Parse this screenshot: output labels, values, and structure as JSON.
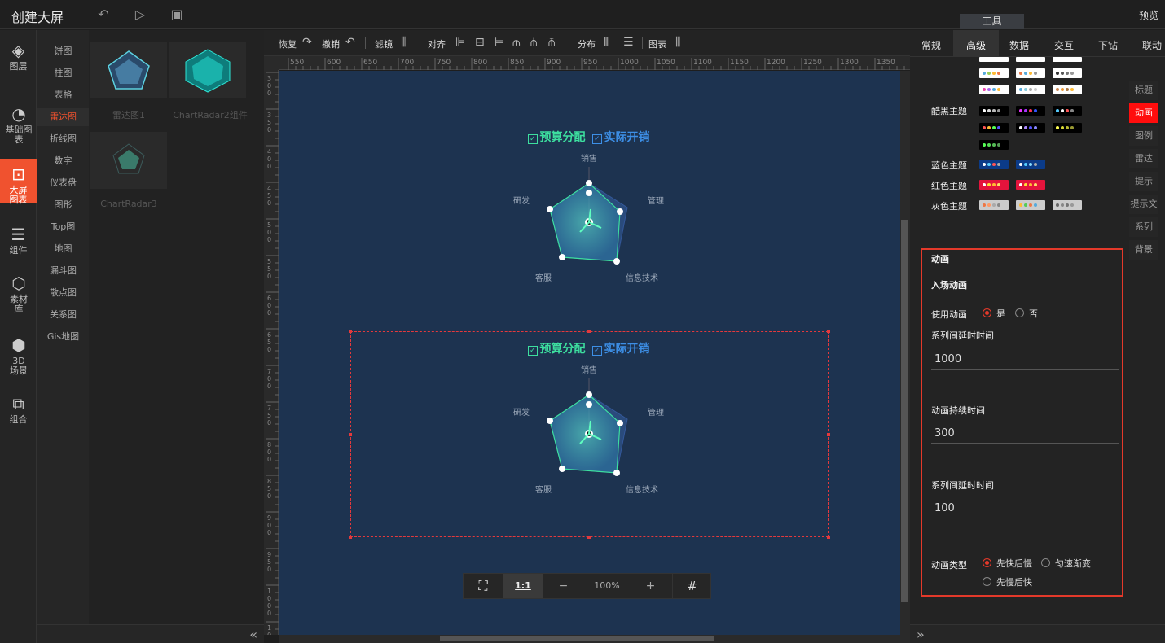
{
  "header": {
    "title": "创建大屏",
    "preview": "预览",
    "tools_tab": "工具"
  },
  "nav": [
    {
      "label": "图层",
      "icon": "layers-icon"
    },
    {
      "label": "基础图表",
      "icon": "pie-chart-icon"
    },
    {
      "label": "大屏图表",
      "icon": "screen-chart-icon"
    },
    {
      "label": "组件",
      "icon": "sliders-icon"
    },
    {
      "label": "素材库",
      "icon": "hexagons-icon"
    },
    {
      "label": "3D场景",
      "icon": "cube-icon"
    },
    {
      "label": "组合",
      "icon": "group-icon"
    }
  ],
  "categories": [
    "饼图",
    "柱图",
    "表格",
    "雷达图",
    "折线图",
    "数字",
    "仪表盘",
    "图形",
    "Top图",
    "地图",
    "漏斗图",
    "散点图",
    "关系图",
    "Gis地图"
  ],
  "thumbs": [
    "雷达图1",
    "ChartRadar2组件",
    "ChartRadar3"
  ],
  "toolbar": {
    "redo": "恢复",
    "undo": "撤销",
    "filter": "滤镜",
    "align": "对齐",
    "distribute": "分布",
    "chart": "图表"
  },
  "ruler": {
    "top": [
      "550",
      "600",
      "650",
      "700",
      "750",
      "800",
      "850",
      "900",
      "950",
      "1000",
      "1050",
      "1100",
      "1150",
      "1200",
      "1250",
      "1300",
      "1350"
    ],
    "left": [
      "300",
      "350",
      "400",
      "450",
      "500",
      "550",
      "600",
      "650",
      "700",
      "750",
      "800",
      "850",
      "900",
      "950",
      "1000",
      "1050"
    ]
  },
  "radar": {
    "legend1": "预算分配",
    "legend2": "实际开销",
    "axes": [
      "销售",
      "管理",
      "信息技术",
      "客服",
      "研发"
    ]
  },
  "zoom": {
    "fit": "⛶",
    "one": "1:1",
    "minus": "−",
    "value": "100%",
    "plus": "+",
    "grid": "#"
  },
  "right_tabs": [
    "常规",
    "高级",
    "数据",
    "交互",
    "下钻",
    "联动"
  ],
  "themes": {
    "dark": "酷黑主题",
    "blue": "蓝色主题",
    "red": "红色主题",
    "gray": "灰色主题"
  },
  "side_menu": [
    "标题",
    "动画",
    "图例",
    "雷达",
    "提示",
    "提示文",
    "系列",
    "背景"
  ],
  "animation": {
    "section": "动画",
    "enter": "入场动画",
    "use_label": "使用动画",
    "yes": "是",
    "no": "否",
    "delay_label": "系列间延时时间",
    "delay_value": "1000",
    "duration_label": "动画持续时间",
    "duration_value": "300",
    "delay2_label": "系列间延时时间",
    "delay2_value": "100",
    "type_label": "动画类型",
    "type1": "先快后慢",
    "type2": "匀速渐变",
    "type3": "先慢后快"
  },
  "colors": {
    "accent": "#f0522f",
    "canvas": "#1d3350",
    "active_red": "#ff0d0d"
  }
}
